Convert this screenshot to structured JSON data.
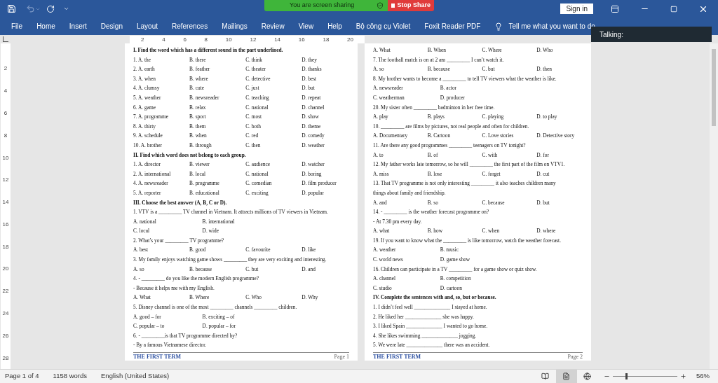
{
  "title_bar": {
    "undo": {
      "disabled": true
    },
    "sign_in": "Sign in"
  },
  "screen_share": {
    "status": "You are screen sharing",
    "stop": "Stop Share"
  },
  "ribbon_tabs": [
    "File",
    "Home",
    "Insert",
    "Design",
    "Layout",
    "References",
    "Mailings",
    "Review",
    "View",
    "Help",
    "Bộ công cụ Violet",
    "Foxit Reader PDF"
  ],
  "tell_me": "Tell me what you want to do",
  "talking": "Talking:",
  "ruler": {
    "horizontal": [
      "2",
      "4",
      "6",
      "8",
      "10",
      "12",
      "14",
      "16",
      "18",
      "20"
    ],
    "vertical": [
      "2",
      "4",
      "6",
      "8",
      "10",
      "12",
      "14",
      "16",
      "18",
      "20",
      "22",
      "24",
      "26",
      "28"
    ]
  },
  "pages": [
    {
      "footer": "THE FIRST TERM",
      "page_label": "Page 1",
      "lines": [
        {
          "kind": "heading",
          "text": "I. Find the word which has a different sound in the part underlined."
        },
        {
          "kind": "options",
          "items": [
            "1. A. the",
            "B. there",
            "C. think",
            "D. they"
          ]
        },
        {
          "kind": "options",
          "items": [
            "2. A. earth",
            "B. feather",
            "C. theater",
            "D. thanks"
          ]
        },
        {
          "kind": "options",
          "items": [
            "3. A. when",
            "B. where",
            "C. detective",
            "D. best"
          ]
        },
        {
          "kind": "options",
          "items": [
            "4. A. clumsy",
            "B. cute",
            "C. just",
            "D. but"
          ]
        },
        {
          "kind": "options",
          "items": [
            "5. A. weather",
            "B. newsreader",
            "C. teaching",
            "D. repeat"
          ]
        },
        {
          "kind": "options",
          "items": [
            "6. A. game",
            "B. relax",
            "C. national",
            "D. channel"
          ]
        },
        {
          "kind": "options",
          "items": [
            "7. A. programme",
            "B. sport",
            "C. most",
            "D. show"
          ]
        },
        {
          "kind": "options",
          "items": [
            "8. A. thirty",
            "B. them",
            "C. both",
            "D. theme"
          ]
        },
        {
          "kind": "options",
          "items": [
            "9. A. schedule",
            "B. when",
            "C. red",
            "D. comedy"
          ]
        },
        {
          "kind": "options",
          "items": [
            "10. A. brother",
            "B. through",
            "C. then",
            "D. weather"
          ]
        },
        {
          "kind": "heading",
          "text": "II. Find which word does not belong to each group."
        },
        {
          "kind": "options",
          "items": [
            "1. A. director",
            "B. viewer",
            "C. audience",
            "D. watcher"
          ]
        },
        {
          "kind": "options",
          "items": [
            "2. A. international",
            "B. local",
            "C. national",
            "D. boring"
          ]
        },
        {
          "kind": "options",
          "items": [
            "4. A. newsreader",
            "B. programme",
            "C. comedian",
            "D. film producer"
          ]
        },
        {
          "kind": "options",
          "items": [
            "5. A. reporter",
            "B. educational",
            "C. exciting",
            "D. popular"
          ]
        },
        {
          "kind": "heading",
          "text": "III. Choose the best answer (A, B, C or D)."
        },
        {
          "kind": "text",
          "text": "1. VTV is a _________ TV channel in Vietnam. It attracts millions of TV viewers in Vietnam."
        },
        {
          "kind": "options",
          "items": [
            "A. national",
            "B. international"
          ]
        },
        {
          "kind": "options",
          "items": [
            "C. local",
            "D. wide"
          ]
        },
        {
          "kind": "text",
          "text": "2. What’s your _________ TV programme?"
        },
        {
          "kind": "options",
          "items": [
            "A. best",
            "B. good",
            "C. favourite",
            "D. like"
          ]
        },
        {
          "kind": "text",
          "text": "3. My family enjoys watching game shows _________ they are very exciting and interesting."
        },
        {
          "kind": "options",
          "items": [
            "A. so",
            "B. because",
            "C. but",
            "D. and"
          ]
        },
        {
          "kind": "text",
          "text": "4. - _________ do you like the modern English programme?"
        },
        {
          "kind": "text",
          "text": "- Because it helps me with my English."
        },
        {
          "kind": "options",
          "items": [
            "A. What",
            "B. Where",
            "C. Who",
            "D. Why"
          ]
        },
        {
          "kind": "text",
          "text": "5. Disney channel is one of the most _________ channels _________ children."
        },
        {
          "kind": "options",
          "items": [
            "A. good – for",
            "B. exciting – of"
          ]
        },
        {
          "kind": "options",
          "items": [
            "C. popular – to",
            "D. popular – for"
          ]
        },
        {
          "kind": "text",
          "text": "6. - _________is that TV programme directed by?"
        },
        {
          "kind": "text",
          "text": "- By a famous Vietnamese director."
        }
      ]
    },
    {
      "footer": "THE FIRST TERM",
      "page_label": "Page 2",
      "lines": [
        {
          "kind": "options",
          "items": [
            "A. What",
            "B. When",
            "C. Where",
            "D. Who"
          ]
        },
        {
          "kind": "text",
          "text": "7. The football match is on at 2 am _________ I can’t watch it."
        },
        {
          "kind": "options",
          "items": [
            "A. so",
            "B. because",
            "C. but",
            "D. then"
          ]
        },
        {
          "kind": "text",
          "text": "8. My brother wants to become a _________ to tell TV viewers what the weather is like."
        },
        {
          "kind": "options",
          "items": [
            "A. newsreader",
            "B. actor"
          ]
        },
        {
          "kind": "options",
          "items": [
            "C. weatherman",
            "D. producer"
          ]
        },
        {
          "kind": "text",
          "text": "20. My sister often _________ badminton in her free time."
        },
        {
          "kind": "options",
          "items": [
            "A. play",
            "B. plays",
            "C. playing",
            "D. to play"
          ]
        },
        {
          "kind": "text",
          "text": "10. _________ are films by pictures, not real people and often for children."
        },
        {
          "kind": "options",
          "items": [
            "A. Documentary",
            "B. Cartoon",
            "C. Love stories",
            "D. Detective story"
          ]
        },
        {
          "kind": "text",
          "text": "11. Are there any good programmes _________ teenagers on TV tonight?"
        },
        {
          "kind": "options",
          "items": [
            "A. to",
            "B. of",
            "C. with",
            "D. for"
          ]
        },
        {
          "kind": "text",
          "text": "12. My father works late tomorrow, so he will _________ the first part of the film on VTV1."
        },
        {
          "kind": "options",
          "items": [
            "A. miss",
            "B. lose",
            "C. forget",
            "D. cut"
          ]
        },
        {
          "kind": "text",
          "text": "13. That TV programme is not only interesting _________ it also teaches children many"
        },
        {
          "kind": "text",
          "text": "things about family and friendship."
        },
        {
          "kind": "options",
          "items": [
            "A. and",
            "B. so",
            "C. because",
            "D. but"
          ]
        },
        {
          "kind": "text",
          "text": "14. - _________ is the weather forecast programme on?"
        },
        {
          "kind": "text",
          "text": "- At 7.30 pm every day."
        },
        {
          "kind": "options",
          "items": [
            "A. what",
            "B. how",
            "C. when",
            "D. where"
          ]
        },
        {
          "kind": "text",
          "text": "19. If you want to know what the _________ is like tomorrow, watch the weather forecast."
        },
        {
          "kind": "options",
          "items": [
            "A. weather",
            "B. music"
          ]
        },
        {
          "kind": "options",
          "items": [
            "C. world news",
            "D. game show"
          ]
        },
        {
          "kind": "text",
          "text": "16. Children can participate in a TV _________ for a game show or quiz show."
        },
        {
          "kind": "options",
          "items": [
            "A. channel",
            "B. competition"
          ]
        },
        {
          "kind": "options",
          "items": [
            "C. studio",
            "D. cartoon"
          ]
        },
        {
          "kind": "heading",
          "text": "IV. Complete the sentences with and, so, but or because."
        },
        {
          "kind": "text",
          "text": "1. I didn’t feel well ______________ I stayed at home."
        },
        {
          "kind": "text",
          "text": "2. He liked her ______________ she was happy."
        },
        {
          "kind": "text",
          "text": "3. I liked Spain ______________ I wanted to go home."
        },
        {
          "kind": "text",
          "text": "4. She likes swimming ______________ jogging."
        },
        {
          "kind": "text",
          "text": "5. We were late ______________ there was an accident."
        }
      ]
    }
  ],
  "status_bar": {
    "page": "Page 1 of 4",
    "words": "1158 words",
    "language": "English (United States)",
    "views": [
      {
        "kind": "read",
        "selected": false
      },
      {
        "kind": "print",
        "selected": true
      },
      {
        "kind": "web",
        "selected": false
      }
    ],
    "zoom": {
      "level": 0.2,
      "label": "56%"
    }
  }
}
